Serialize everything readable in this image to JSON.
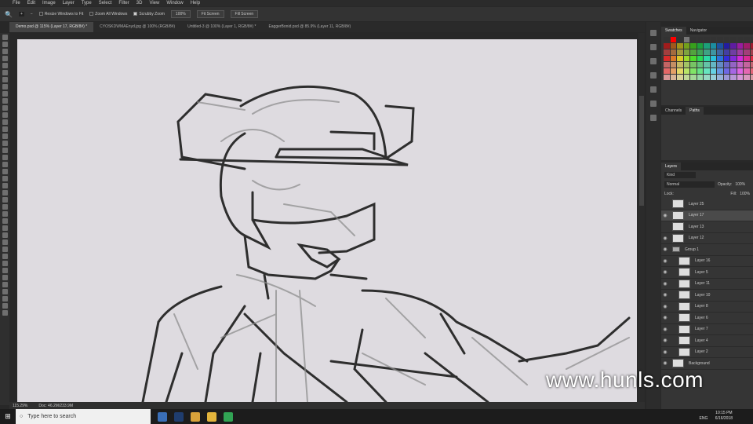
{
  "menu": [
    "File",
    "Edit",
    "Image",
    "Layer",
    "Type",
    "Select",
    "Filter",
    "3D",
    "View",
    "Window",
    "Help"
  ],
  "options": {
    "resize": "Resize Windows to Fit",
    "zoom_all": "Zoom All Windows",
    "scrubby": "Scrubby Zoom",
    "pct": "100%",
    "fit": "Fit Screen",
    "fill": "Fill Screen"
  },
  "tabs": [
    "Demo.psd @ 115% (Layer 17, RGB/8#) *",
    "CYOSKDWMAEnyd.jpg @ 100% (RGB/8#)",
    "Untitled-3 @ 100% (Layer 1, RGB/8#) *",
    "EaggerBonid.psd @ 85.9% (Layer 11, RGB/8#)"
  ],
  "status": {
    "zoom": "115.29%",
    "doc": "Doc: 46.2M/233.9M"
  },
  "swatch_tabs": [
    "Swatches",
    "Navigator"
  ],
  "channel_tabs": [
    "Channels",
    "Paths"
  ],
  "layers_panel": {
    "title": "Layers",
    "filter": "Kind",
    "blend": "Normal",
    "opacity_label": "Opacity:",
    "opacity": "100%",
    "lock_label": "Lock:",
    "fill_label": "Fill:",
    "fill": "100%"
  },
  "layers": [
    {
      "name": "Layer 25",
      "visible": false
    },
    {
      "name": "Layer 17",
      "visible": true,
      "selected": true
    },
    {
      "name": "Layer 13",
      "visible": false
    },
    {
      "name": "Layer 12",
      "visible": true
    },
    {
      "name": "Group 1",
      "visible": true,
      "group": true
    },
    {
      "name": "Layer 16",
      "visible": true
    },
    {
      "name": "Layer 5",
      "visible": true
    },
    {
      "name": "Layer 11",
      "visible": true
    },
    {
      "name": "Layer 10",
      "visible": true
    },
    {
      "name": "Layer 8",
      "visible": true
    },
    {
      "name": "Layer 6",
      "visible": true
    },
    {
      "name": "Layer 7",
      "visible": true
    },
    {
      "name": "Layer 4",
      "visible": true
    },
    {
      "name": "Layer 2",
      "visible": true
    },
    {
      "name": "Background",
      "visible": true
    }
  ],
  "taskbar": {
    "search": "Type here to search",
    "lang": "ENG",
    "time": "10:15 PM",
    "date": "6/16/2018"
  },
  "watermark": "www.hunls.com"
}
